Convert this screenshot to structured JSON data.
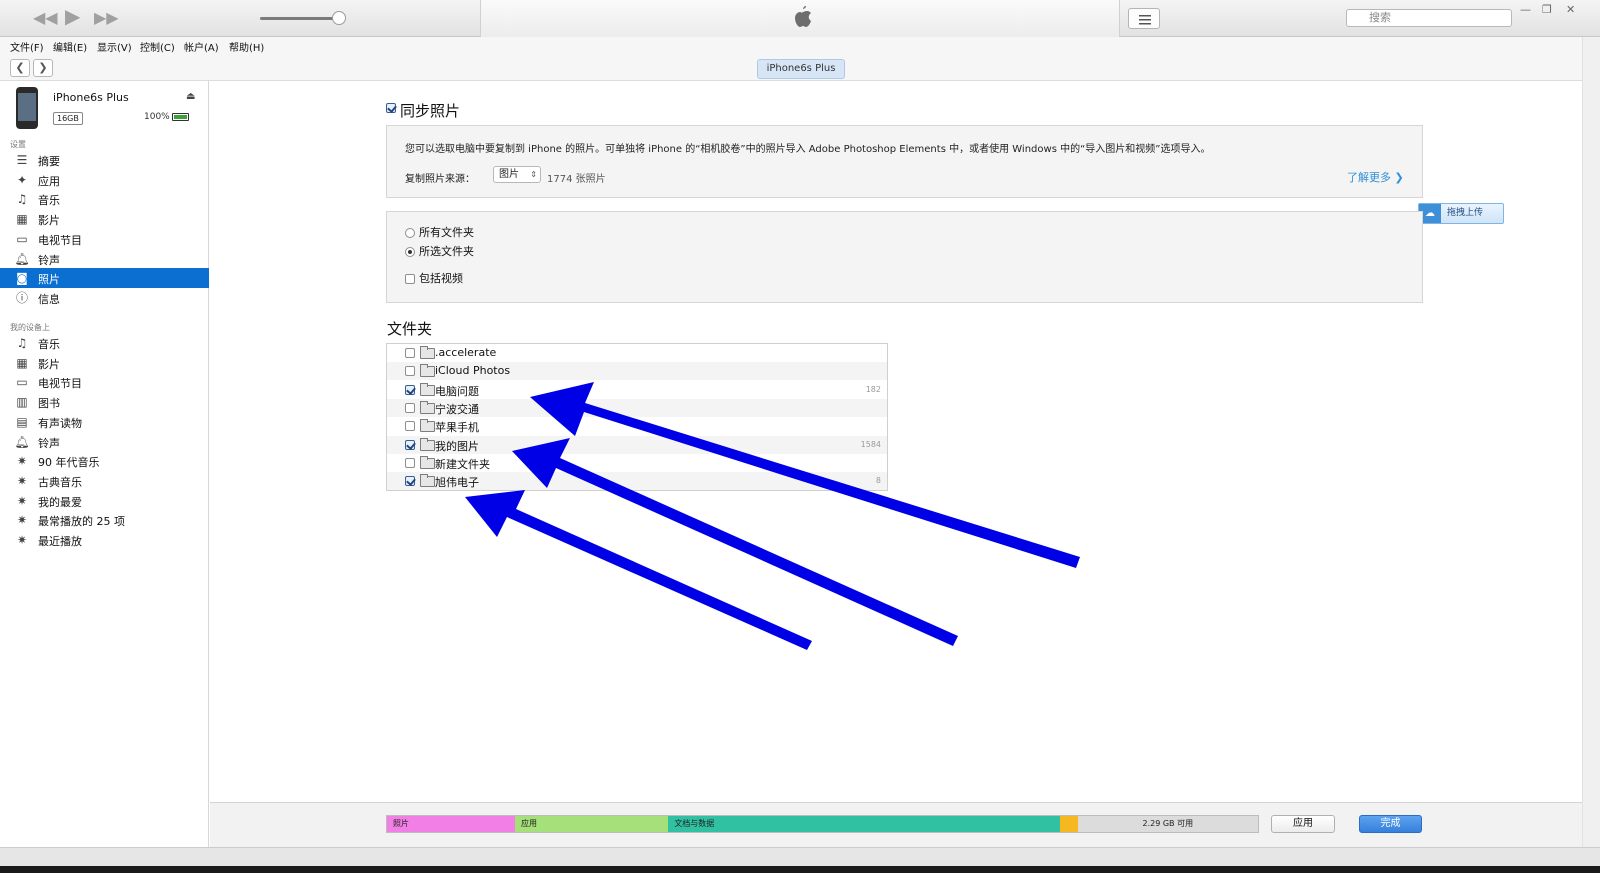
{
  "toolbar": {
    "rewind_icon": "rewind-icon",
    "play_icon": "play-icon",
    "forward_icon": "fast-forward-icon",
    "search_placeholder": "搜索"
  },
  "menu": [
    "文件(F)",
    "编辑(E)",
    "显示(V)",
    "控制(C)",
    "帐户(A)",
    "帮助(H)"
  ],
  "nav": {
    "device_tab": "iPhone6s Plus"
  },
  "device": {
    "name": "iPhone6s Plus",
    "capacity": "16GB",
    "battery": "100%"
  },
  "sidebar": {
    "settings_header": "设置",
    "settings_items": [
      {
        "label": "摘要",
        "icon": "summary-icon"
      },
      {
        "label": "应用",
        "icon": "apps-icon"
      },
      {
        "label": "音乐",
        "icon": "music-icon"
      },
      {
        "label": "影片",
        "icon": "movies-icon"
      },
      {
        "label": "电视节目",
        "icon": "tv-icon"
      },
      {
        "label": "铃声",
        "icon": "bell-icon"
      },
      {
        "label": "照片",
        "icon": "camera-icon",
        "selected": true
      },
      {
        "label": "信息",
        "icon": "info-icon"
      }
    ],
    "on_device_header": "我的设备上",
    "device_items": [
      {
        "label": "音乐",
        "icon": "music-icon"
      },
      {
        "label": "影片",
        "icon": "movies-icon"
      },
      {
        "label": "电视节目",
        "icon": "tv-icon"
      },
      {
        "label": "图书",
        "icon": "book-icon"
      },
      {
        "label": "有声读物",
        "icon": "audiobook-icon"
      },
      {
        "label": "铃声",
        "icon": "bell-icon"
      },
      {
        "label": "90 年代音乐",
        "icon": "gear-icon"
      },
      {
        "label": "古典音乐",
        "icon": "gear-icon"
      },
      {
        "label": "我的最爱",
        "icon": "gear-icon"
      },
      {
        "label": "最常播放的 25 项",
        "icon": "gear-icon"
      },
      {
        "label": "最近播放",
        "icon": "gear-icon"
      }
    ]
  },
  "photos": {
    "sync_label": "同步照片",
    "sync_checked": true,
    "info_text": "您可以选取电脑中要复制到 iPhone 的照片。可单独将 iPhone 的“相机胶卷”中的照片导入 Adobe Photoshop Elements 中，或者使用 Windows 中的“导入图片和视频”选项导入。",
    "copy_from_label": "复制照片来源：",
    "source_value": "图片",
    "photo_count": "1774 张照片",
    "learn_more": "了解更多",
    "upload_label": "拖拽上传",
    "options": [
      {
        "type": "radio",
        "label": "所有文件夹",
        "checked": false
      },
      {
        "type": "radio",
        "label": "所选文件夹",
        "checked": true
      },
      {
        "type": "checkbox",
        "label": "包括视频",
        "checked": false
      }
    ],
    "folders_title": "文件夹",
    "folders": [
      {
        "name": ".accelerate",
        "checked": false,
        "count": ""
      },
      {
        "name": "iCloud Photos",
        "checked": false,
        "count": ""
      },
      {
        "name": "电脑问题",
        "checked": true,
        "count": "182"
      },
      {
        "name": "宁波交通",
        "checked": false,
        "count": ""
      },
      {
        "name": "苹果手机",
        "checked": false,
        "count": ""
      },
      {
        "name": "我的图片",
        "checked": true,
        "count": "1584"
      },
      {
        "name": "新建文件夹",
        "checked": false,
        "count": ""
      },
      {
        "name": "旭伟电子",
        "checked": true,
        "count": "8"
      }
    ]
  },
  "capacity_bar": [
    {
      "label": "照片",
      "color": "#f27fe6",
      "fraction": 0.147
    },
    {
      "label": "应用",
      "color": "#a6e07a",
      "fraction": 0.176
    },
    {
      "label": "文档与数据",
      "color": "#2fc1a2",
      "fraction": 0.45
    },
    {
      "label": "",
      "color": "#f5b820",
      "fraction": 0.02
    },
    {
      "label": "2.29 GB 可用",
      "color": "#dcdcdc",
      "fraction": 0.207
    }
  ],
  "buttons": {
    "apply": "应用",
    "done": "完成"
  },
  "colors": {
    "selected": "#0a6fd1",
    "arrow": "#0000e6",
    "link": "#2f8fd6"
  }
}
